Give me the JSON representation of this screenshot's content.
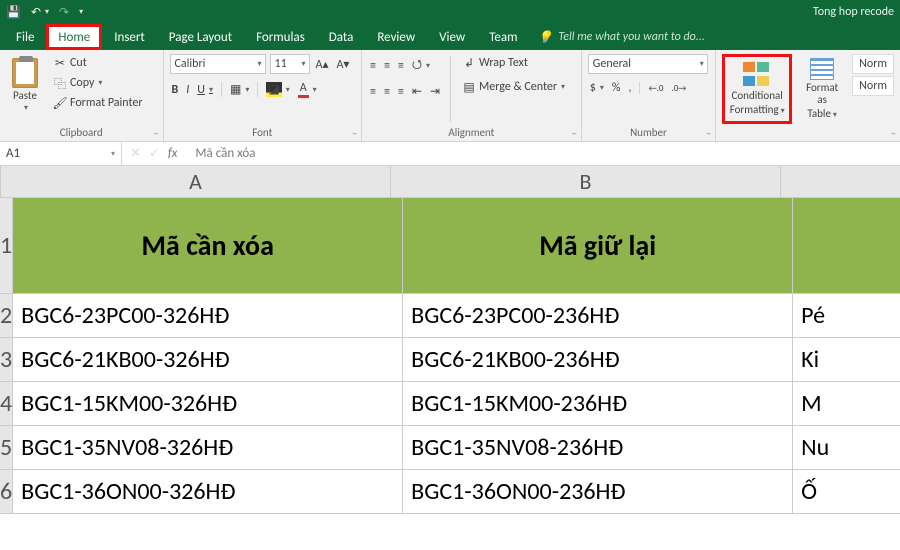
{
  "titlebar": {
    "save_icon": "💾",
    "undo_icon": "↶",
    "redo_icon": "↷",
    "qat_drop": "▾",
    "doc_title": "Tong hop recode"
  },
  "tabs": {
    "file": "File",
    "home": "Home",
    "insert": "Insert",
    "page_layout": "Page Layout",
    "formulas": "Formulas",
    "data": "Data",
    "review": "Review",
    "view": "View",
    "team": "Team",
    "tell_icon": "💡",
    "tell_me": "Tell me what you want to do..."
  },
  "ribbon": {
    "clipboard": {
      "paste": "Paste",
      "cut_icon": "✂",
      "cut": "Cut",
      "copy_icon": "⿻",
      "copy": "Copy",
      "fp_icon": "🖌",
      "format_painter": "Format Painter",
      "label": "Clipboard"
    },
    "font": {
      "name": "Calibri",
      "size": "11",
      "inc": "A▴",
      "dec": "A▾",
      "bold": "B",
      "italic": "I",
      "underline": "U",
      "border_icon": "▦",
      "fill_icon": "◪",
      "color_icon": "A",
      "label": "Font"
    },
    "alignment": {
      "al_t": "≡",
      "al_m": "≡",
      "al_b": "≡",
      "al_l": "≡",
      "al_c": "≡",
      "al_r": "≡",
      "orient": "⭯",
      "indent_dec": "⇤",
      "indent_inc": "⇥",
      "wrap_icon": "↲",
      "wrap": "Wrap Text",
      "merge_icon": "▤",
      "merge": "Merge & Center",
      "label": "Alignment"
    },
    "number": {
      "format": "General",
      "currency": "$",
      "percent": "%",
      "comma": ",",
      "inc_dec": "←.0",
      "dec_dec": ".0→",
      "label": "Number"
    },
    "styles": {
      "cf_line1": "Conditional",
      "cf_line2": "Formatting",
      "fat_line1": "Format as",
      "fat_line2": "Table",
      "normal": "Norm",
      "normal2": "Norm"
    }
  },
  "formula_bar": {
    "name_box": "A1",
    "cancel": "✕",
    "enter": "✓",
    "fx": "fx",
    "value": "Mã cần xóa"
  },
  "grid": {
    "col_labels": {
      "A": "A",
      "B": "B",
      "C": ""
    },
    "row_labels": [
      "1",
      "2",
      "3",
      "4",
      "5",
      "6"
    ],
    "header_row": {
      "A": "Mã cần xóa",
      "B": "Mã giữ lại",
      "C": ""
    },
    "rows": [
      {
        "A": "BGC6-23PC00-326HĐ",
        "B": "BGC6-23PC00-236HĐ",
        "C": "Pé"
      },
      {
        "A": "BGC6-21KB00-326HĐ",
        "B": "BGC6-21KB00-236HĐ",
        "C": "Ki"
      },
      {
        "A": "BGC1-15KM00-326HĐ",
        "B": "BGC1-15KM00-236HĐ",
        "C": "M"
      },
      {
        "A": "BGC1-35NV08-326HĐ",
        "B": "BGC1-35NV08-236HĐ",
        "C": "Nu"
      },
      {
        "A": "BGC1-36ON00-326HĐ",
        "B": "BGC1-36ON00-236HĐ",
        "C": "Ố"
      }
    ]
  },
  "colors": {
    "excel_green": "#0e6837",
    "header_fill": "#8fb34d",
    "highlight_red": "#e11"
  }
}
